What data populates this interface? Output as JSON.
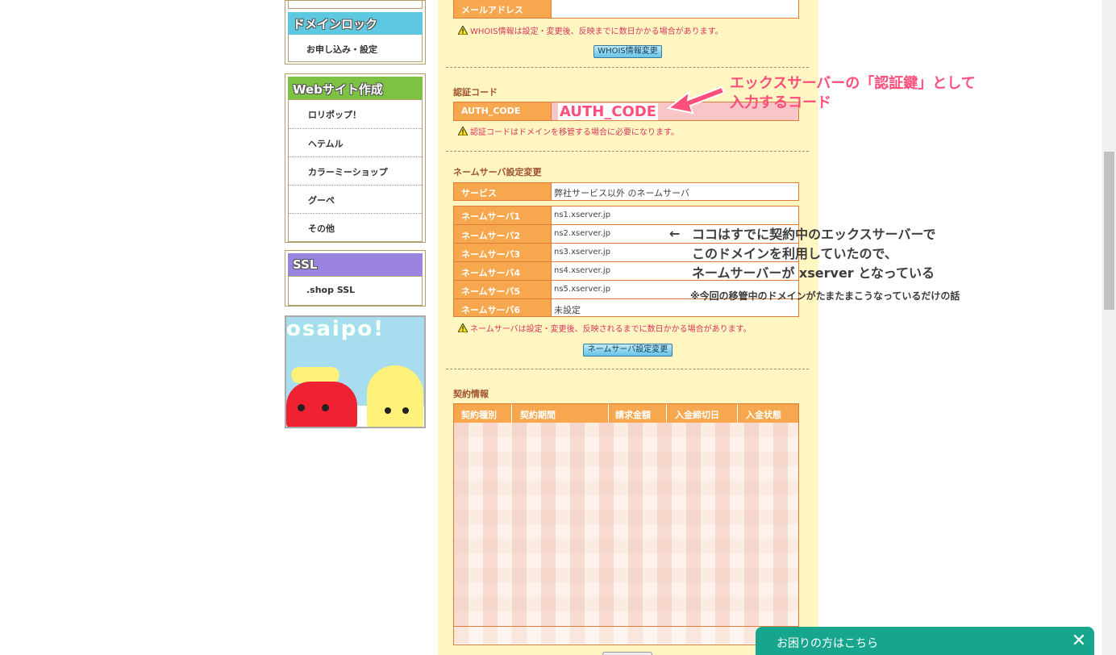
{
  "sidebar": {
    "domain_lock": {
      "title": "ドメインロック",
      "items": [
        "お申し込み・設定"
      ]
    },
    "website": {
      "title": "Webサイト作成",
      "items": [
        "ロリポップ！",
        "ヘテムル",
        "カラーミーショップ",
        "グーペ",
        "その他"
      ]
    },
    "ssl": {
      "title": "SSL",
      "items": [
        ".shop SSL"
      ]
    },
    "banner_text": "osaipo!"
  },
  "whois": {
    "email_label": "メールアドレス",
    "email_value": "",
    "warning": "WHOIS情報は設定・変更後、反映までに数日かかる場合があります。",
    "button": "WHOIS情報変更"
  },
  "auth": {
    "title": "認証コード",
    "label": "AUTH_CODE",
    "value": "AUTH_CODE",
    "warning": "認証コードはドメインを移管する場合に必要になります。"
  },
  "nameserver": {
    "title": "ネームサーバ設定変更",
    "service_label": "サービス",
    "service_value": "弊社サービス以外 のネームサーバ",
    "rows": [
      {
        "label": "ネームサーバ1",
        "value": "ns1.xserver.jp"
      },
      {
        "label": "ネームサーバ2",
        "value": "ns2.xserver.jp"
      },
      {
        "label": "ネームサーバ3",
        "value": "ns3.xserver.jp"
      },
      {
        "label": "ネームサーバ4",
        "value": "ns4.xserver.jp"
      },
      {
        "label": "ネームサーバ5",
        "value": "ns5.xserver.jp"
      },
      {
        "label": "ネームサーバ6",
        "value": "未設定"
      }
    ],
    "warning": "ネームサーバは設定・変更後、反映されるまでに数日かかる場合があります。",
    "button": "ネームサーバ設定変更"
  },
  "contract": {
    "title": "契約情報",
    "columns": [
      "契約種別",
      "契約期間",
      "請求金額",
      "入金締切日",
      "入金状態"
    ]
  },
  "annotations": {
    "auth_line1": "エックスサーバーの「認証鍵」として",
    "auth_line2": "入力するコード",
    "ns_arrow": "←",
    "ns_line1": "ココはすでに契約中のエックスサーバーで",
    "ns_line2": "このドメインを利用していたので、",
    "ns_line3": "ネームサーバーが xserver となっている",
    "ns_note": "※今回の移管中のドメインがたまたまこうなっているだけの話"
  },
  "help": {
    "label": "お困りの方はこちら",
    "close": "✕"
  },
  "colors": {
    "accent_pink": "#ff4f7b",
    "table_header": "#f7a84f",
    "main_bg": "#fff6c2",
    "help_bg": "#17a68d"
  }
}
